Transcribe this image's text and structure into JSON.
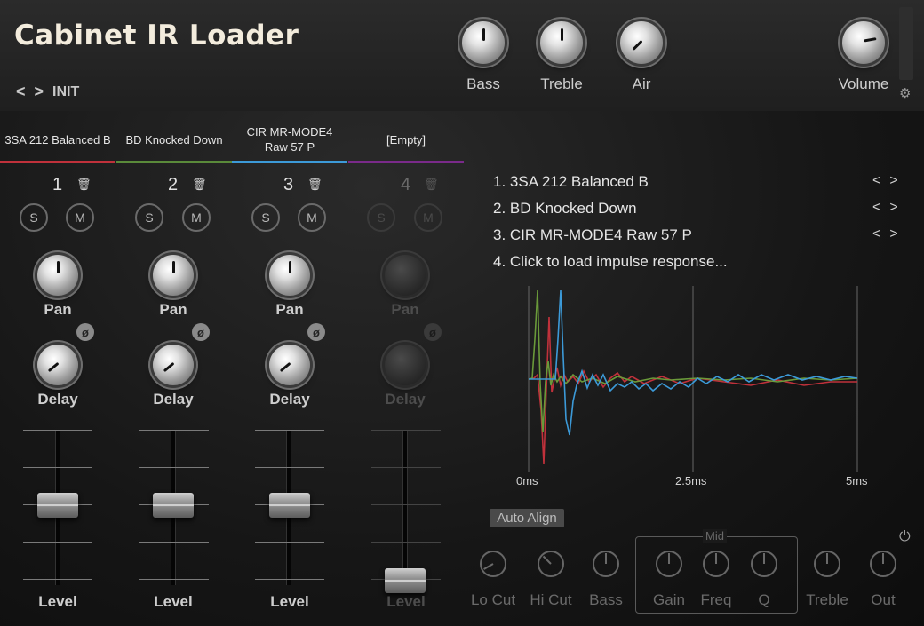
{
  "app": {
    "title": "Cabinet IR Loader",
    "preset_name": "INIT",
    "prev_arrow": "<",
    "next_arrow": ">"
  },
  "master_knobs": [
    {
      "label": "Bass"
    },
    {
      "label": "Treble"
    },
    {
      "label": "Air"
    },
    {
      "label": "Volume"
    }
  ],
  "channels": [
    {
      "tab": "3SA 212 Balanced B",
      "number": "1",
      "solo": "S",
      "mute": "M",
      "pan_label": "Pan",
      "delay_label": "Delay",
      "level_label": "Level",
      "phase": "ø",
      "color": "#c0313b"
    },
    {
      "tab": "BD Knocked Down",
      "number": "2",
      "solo": "S",
      "mute": "M",
      "pan_label": "Pan",
      "delay_label": "Delay",
      "level_label": "Level",
      "phase": "ø",
      "color": "#5a8a3a"
    },
    {
      "tab": "CIR MR-MODE4 Raw 57 P",
      "number": "3",
      "solo": "S",
      "mute": "M",
      "pan_label": "Pan",
      "delay_label": "Delay",
      "level_label": "Level",
      "phase": "ø",
      "color": "#3c9ad8"
    },
    {
      "tab": "[Empty]",
      "number": "4",
      "solo": "S",
      "mute": "M",
      "pan_label": "Pan",
      "delay_label": "Delay",
      "level_label": "Level",
      "phase": "ø",
      "color": "#7a2a8a"
    }
  ],
  "ir_list": [
    {
      "text": "1. 3SA 212 Balanced B",
      "arrows": "<>"
    },
    {
      "text": "2. BD Knocked Down",
      "arrows": "<>"
    },
    {
      "text": "3. CIR MR-MODE4 Raw 57 P",
      "arrows": "<>"
    },
    {
      "text": "4. Click to load impulse response...",
      "arrows": ""
    }
  ],
  "plot": {
    "time_labels": [
      "0ms",
      "2.5ms",
      "5ms"
    ]
  },
  "eq": {
    "auto_align": "Auto Align",
    "mid_label": "Mid",
    "knobs": [
      {
        "label": "Lo Cut"
      },
      {
        "label": "Hi Cut"
      },
      {
        "label": "Bass"
      },
      {
        "label": "Gain"
      },
      {
        "label": "Freq"
      },
      {
        "label": "Q"
      },
      {
        "label": "Treble"
      },
      {
        "label": "Out"
      }
    ]
  }
}
